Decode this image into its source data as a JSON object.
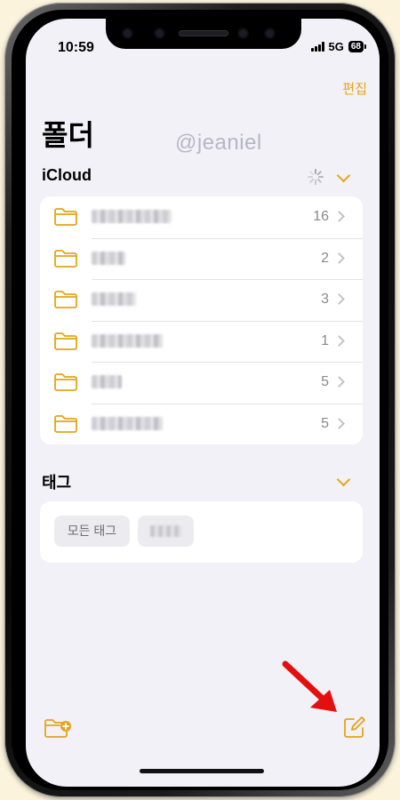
{
  "status": {
    "time": "10:59",
    "network": "5G",
    "battery": "68"
  },
  "header": {
    "edit_label": "편집",
    "title": "폴더",
    "watermark": "@jeaniel"
  },
  "icloud": {
    "heading": "iCloud",
    "folders": [
      {
        "count": "16"
      },
      {
        "count": "2"
      },
      {
        "count": "3"
      },
      {
        "count": "1"
      },
      {
        "count": "5"
      },
      {
        "count": "5"
      }
    ]
  },
  "tags": {
    "heading": "태그",
    "all_label": "모든 태그"
  },
  "icons": {
    "new_folder": "folder-plus-icon",
    "compose": "compose-icon",
    "annotation": "red-arrow-icon"
  },
  "colors": {
    "accent": "#e2a41a",
    "background": "#f2f1f7",
    "arrow": "#e4100f"
  }
}
